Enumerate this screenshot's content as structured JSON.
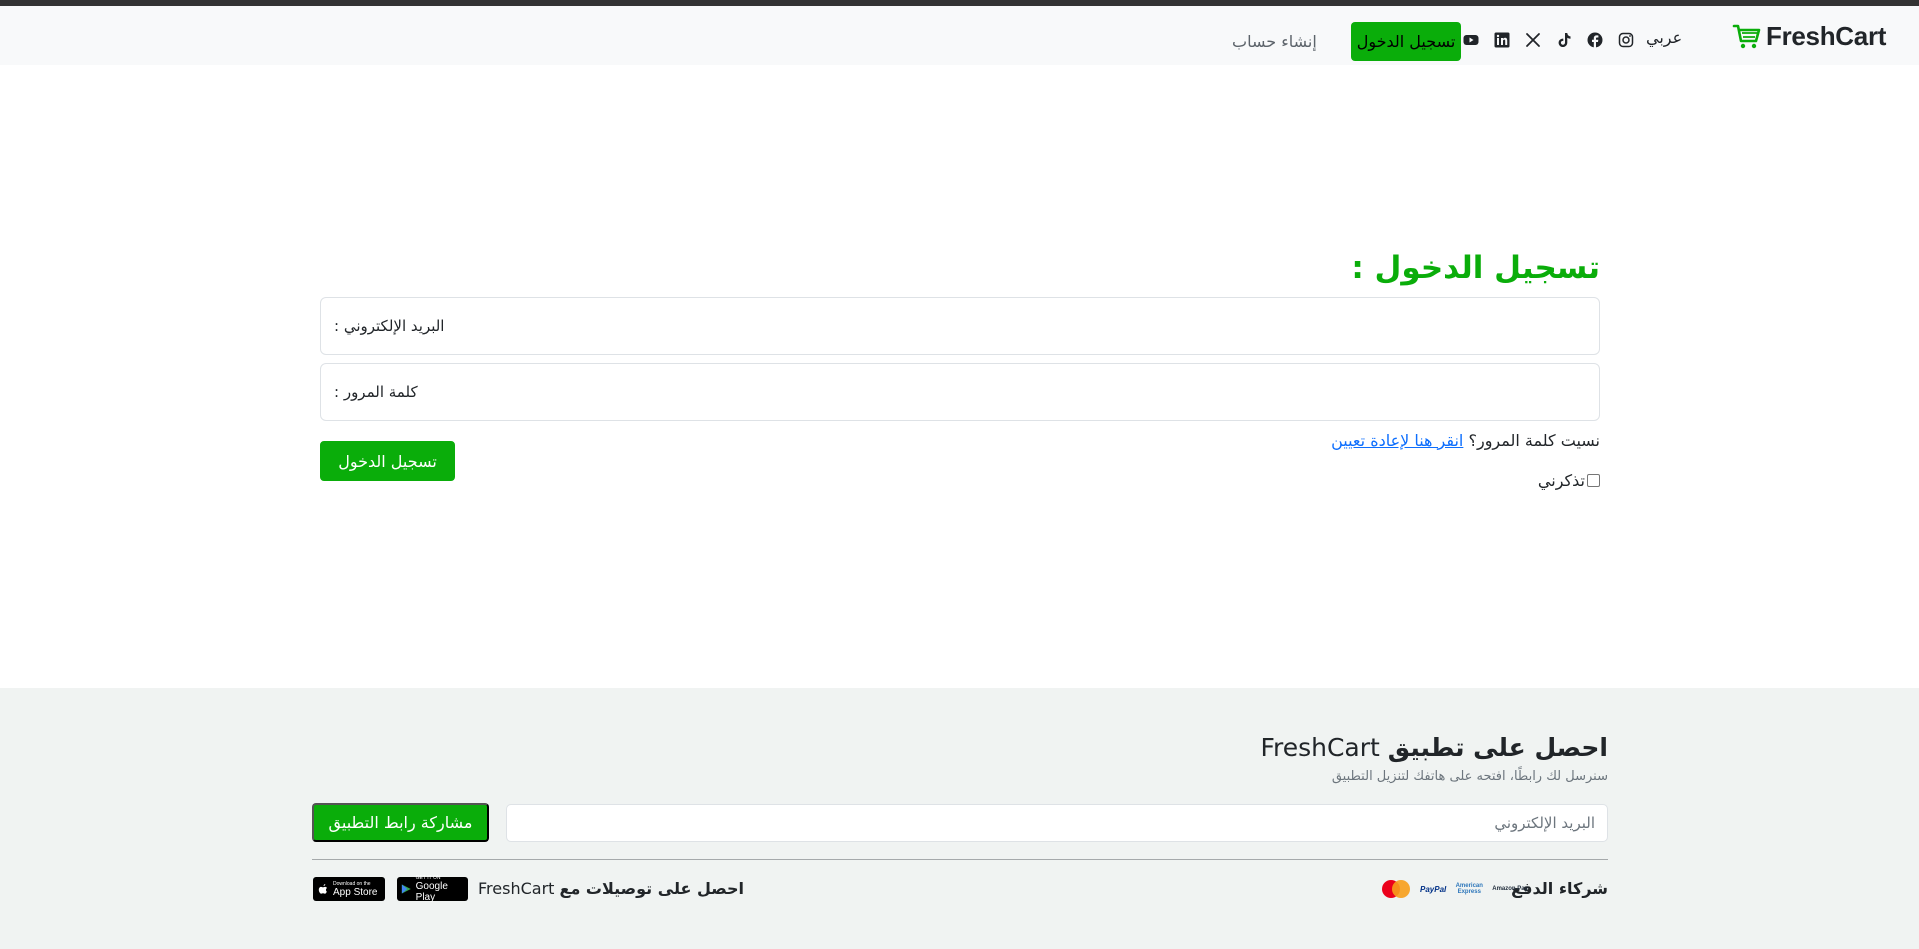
{
  "navbar": {
    "logo_text": "FreshCart",
    "language": "عربي",
    "social_icons": [
      "instagram-icon",
      "facebook-icon",
      "tiktok-icon",
      "x-icon",
      "linkedin-icon",
      "youtube-icon"
    ],
    "login_label": "تسجيل الدخول",
    "register_label": "إنشاء حساب"
  },
  "login": {
    "title": "تسجيل الدخول :",
    "email_placeholder": "البريد الإلكتروني :",
    "password_placeholder": "كلمة المرور :",
    "forgot_text": "نسيت كلمة المرور؟",
    "forgot_link": "انقر هنا لإعادة تعيين",
    "submit_label": "تسجيل الدخول",
    "remember_label": "تذكرني"
  },
  "footer": {
    "title_prefix": "احصل على تطبيق",
    "title_brand": "FreshCart",
    "subtitle": "سنرسل لك رابطًا، افتحه على هاتفك لتنزيل التطبيق",
    "email_placeholder": "البريد الإلكتروني",
    "share_label": "مشاركة رابط التطبيق",
    "partners_label": "شركاء الدفع",
    "payment_logos": [
      "Amazon Pay",
      "American Express",
      "PayPal",
      "MasterCard"
    ],
    "deliveries_prefix": "احصل على توصيلات مع",
    "deliveries_brand": "FreshCart",
    "google_play_small": "GET IT ON",
    "google_play_big": "Google Play",
    "app_store_small": "Download on the",
    "app_store_big": "App Store"
  },
  "colors": {
    "brand_green": "#0aad0a",
    "link_blue": "#0d6efd",
    "footer_bg": "#f0f3f2"
  }
}
